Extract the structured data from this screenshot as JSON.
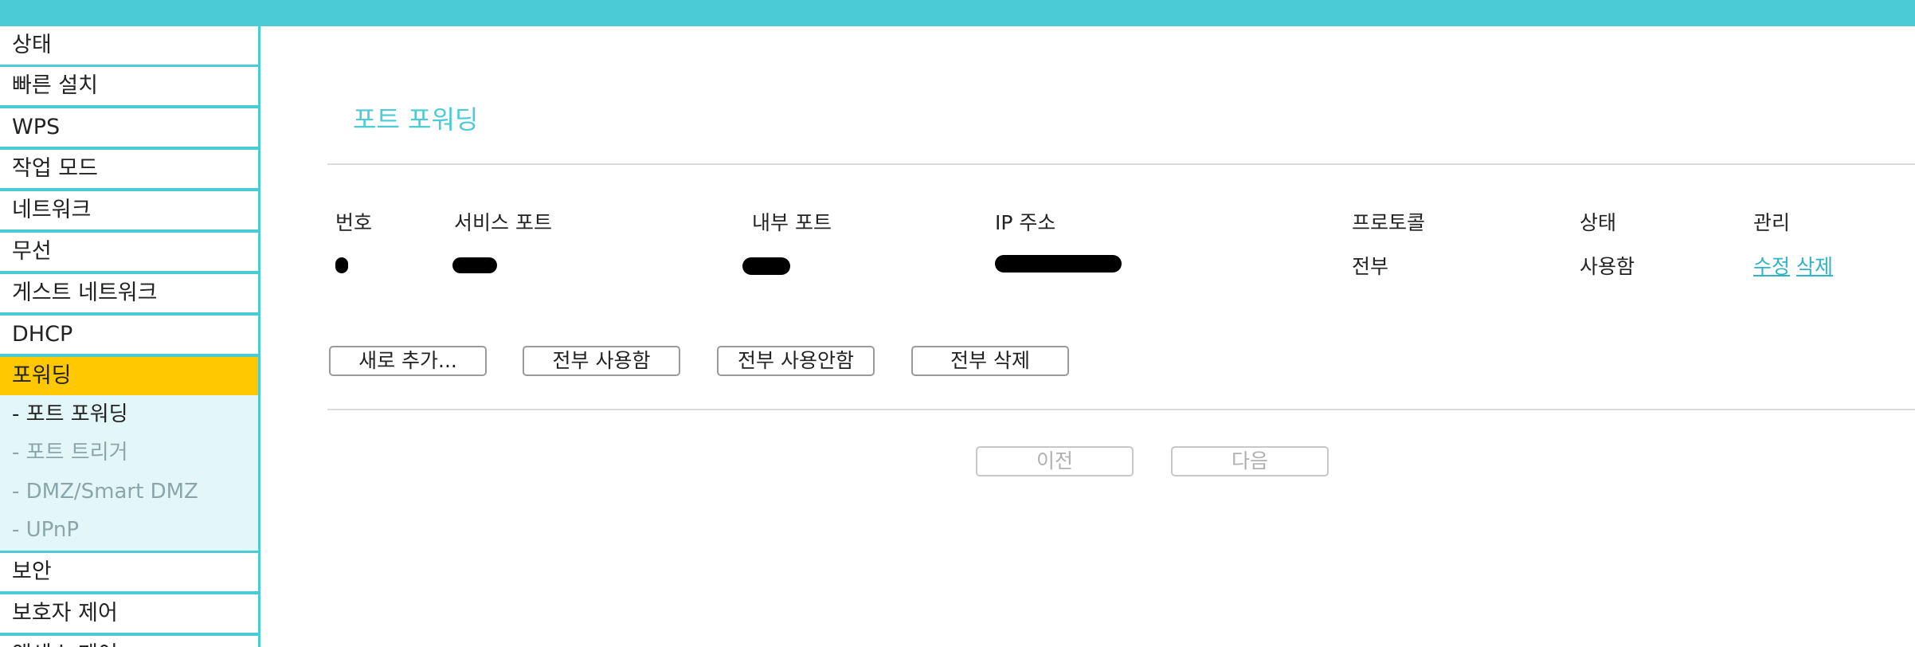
{
  "sidebar": {
    "items": [
      {
        "label": "상태"
      },
      {
        "label": "빠른 설치"
      },
      {
        "label": "WPS"
      },
      {
        "label": "작업 모드"
      },
      {
        "label": "네트워크"
      },
      {
        "label": "무선"
      },
      {
        "label": "게스트 네트워크"
      },
      {
        "label": "DHCP"
      },
      {
        "label": "포워딩"
      },
      {
        "label": "보안"
      },
      {
        "label": "보호자 제어"
      },
      {
        "label": "액세스 제어"
      }
    ],
    "active_item": "포워딩",
    "sub_items": [
      {
        "label": "- 포트 포워딩"
      },
      {
        "label": "- 포트 트리거"
      },
      {
        "label": "- DMZ/Smart DMZ"
      },
      {
        "label": "- UPnP"
      }
    ],
    "current_sub_item": "- 포트 포워딩"
  },
  "main": {
    "title": "포트 포워딩",
    "table": {
      "headers": [
        "번호",
        "서비스 포트",
        "내부 포트",
        "IP 주소",
        "프로토콜",
        "상태",
        "관리"
      ],
      "rows": [
        {
          "protocol": "전부",
          "status": "사용함",
          "edit": "수정",
          "delete": "삭제"
        }
      ]
    },
    "buttons": {
      "add": "새로 추가...",
      "enable_all": "전부 사용함",
      "disable_all": "전부 사용안함",
      "delete_all": "전부 삭제"
    },
    "pagination": {
      "prev": "이전",
      "next": "다음"
    }
  },
  "colors": {
    "accent": "#4acbd6",
    "active": "#ffc800",
    "submenu_bg": "#e3f7f8"
  }
}
